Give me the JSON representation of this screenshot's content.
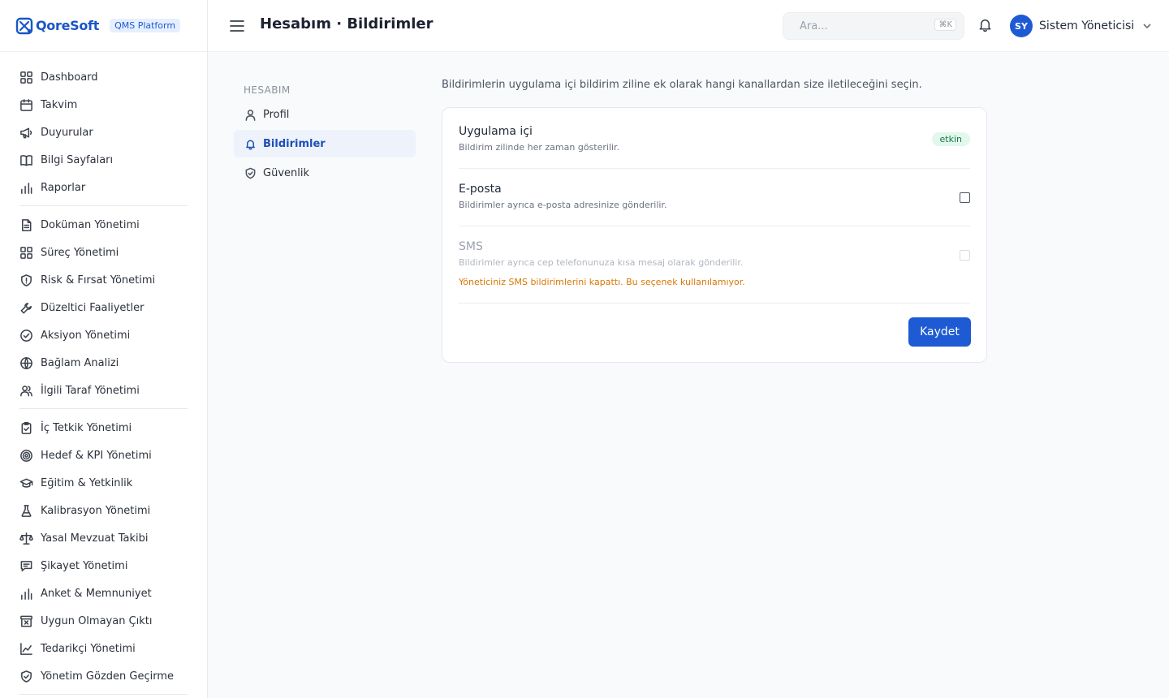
{
  "brand": {
    "logo_text": "QoreSoft",
    "platform_badge": "QMS Platform",
    "accent_color": "#1d5ad3"
  },
  "sidebar": {
    "groups": [
      [
        {
          "label": "Dashboard",
          "icon": "grid-icon"
        },
        {
          "label": "Takvim",
          "icon": "calendar-icon"
        },
        {
          "label": "Duyurular",
          "icon": "megaphone-icon"
        },
        {
          "label": "Bilgi Sayfaları",
          "icon": "book-icon"
        },
        {
          "label": "Raporlar",
          "icon": "bar-chart-icon"
        }
      ],
      [
        {
          "label": "Doküman Yönetimi",
          "icon": "document-icon"
        },
        {
          "label": "Süreç Yönetimi",
          "icon": "grid-icon"
        },
        {
          "label": "Risk & Fırsat Yönetimi",
          "icon": "shield-icon"
        },
        {
          "label": "Düzeltici Faaliyetler",
          "icon": "wrench-icon"
        },
        {
          "label": "Aksiyon Yönetimi",
          "icon": "check-circle-icon"
        },
        {
          "label": "Bağlam Analizi",
          "icon": "globe-icon"
        },
        {
          "label": "İlgili Taraf Yönetimi",
          "icon": "users-icon"
        }
      ],
      [
        {
          "label": "İç Tetkik Yönetimi",
          "icon": "clipboard-check-icon"
        },
        {
          "label": "Hedef & KPI Yönetimi",
          "icon": "target-icon"
        },
        {
          "label": "Eğitim & Yetkinlik",
          "icon": "graduation-cap-icon"
        },
        {
          "label": "Kalibrasyon Yönetimi",
          "icon": "flask-icon"
        },
        {
          "label": "Yasal Mevzuat Takibi",
          "icon": "scale-icon"
        },
        {
          "label": "Şikayet Yönetimi",
          "icon": "message-icon"
        },
        {
          "label": "Anket & Memnuniyet",
          "icon": "bar-chart-icon"
        },
        {
          "label": "Uygun Olmayan Çıktı",
          "icon": "archive-x-icon"
        },
        {
          "label": "Tedarikçi Yönetimi",
          "icon": "line-chart-icon"
        },
        {
          "label": "Yönetim Gözden Geçirme",
          "icon": "shield-check-icon"
        }
      ]
    ]
  },
  "header": {
    "title": "Hesabım · Bildirimler",
    "search_placeholder": "Ara...",
    "search_shortcut": "⌘K",
    "user_initials": "SY",
    "user_name": "Sistem Yöneticisi"
  },
  "account_nav": {
    "heading": "HESABIM",
    "items": [
      {
        "label": "Profil",
        "icon": "user-icon",
        "active": false
      },
      {
        "label": "Bildirimler",
        "icon": "bell-icon",
        "active": true
      },
      {
        "label": "Güvenlik",
        "icon": "shield-check-icon",
        "active": false
      }
    ]
  },
  "notifications": {
    "description": "Bildirimlerin uygulama içi bildirim ziline ek olarak hangi kanallardan size iletileceğini seçin.",
    "channels": [
      {
        "title": "Uygulama içi",
        "subtitle": "Bildirim zilinde her zaman gösterilir.",
        "status_badge": "etkin"
      },
      {
        "title": "E-posta",
        "subtitle": "Bildirimler ayrıca e-posta adresinize gönderilir.",
        "checked": false
      },
      {
        "title": "SMS",
        "subtitle": "Bildirimler ayrıca cep telefonunuza kısa mesaj olarak gönderilir.",
        "checked": false,
        "disabled": true,
        "warning": "Yöneticiniz SMS bildirimlerini kapattı. Bu seçenek kullanılamıyor."
      }
    ],
    "save_label": "Kaydet"
  }
}
